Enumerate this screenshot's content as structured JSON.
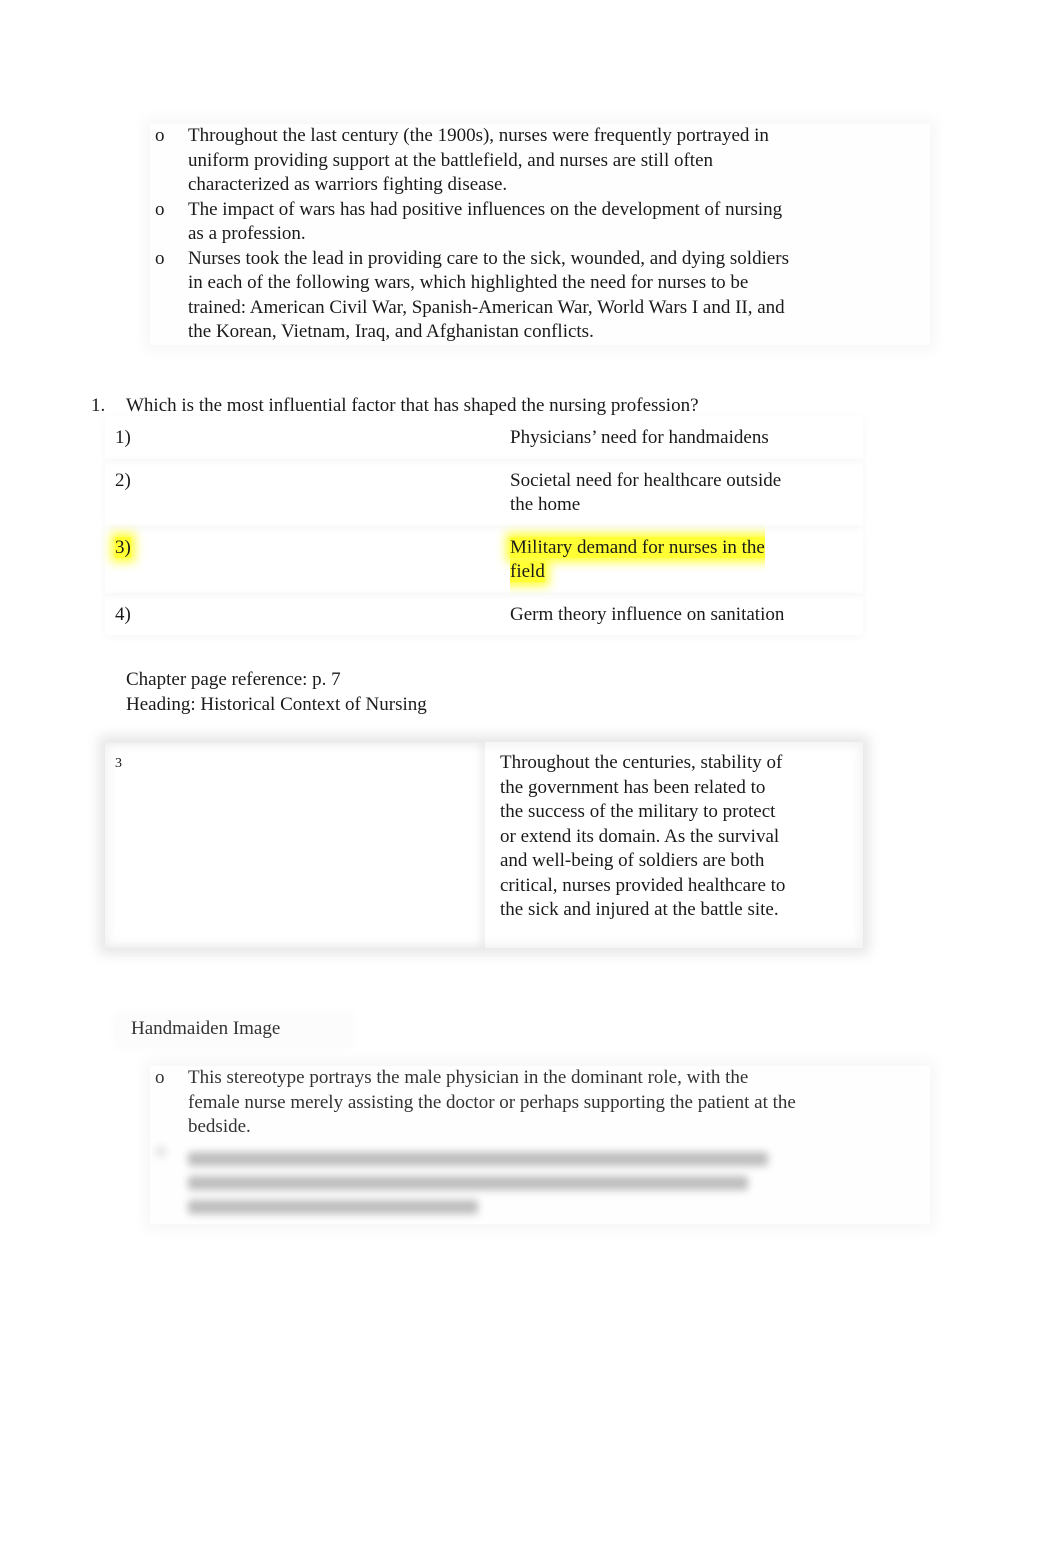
{
  "top_bullets": {
    "marker": "o",
    "items": [
      "Throughout the last century (the 1900s), nurses were frequently portrayed in uniform providing support at the battlefield, and nurses are still often characterized as warriors fighting disease.",
      "The impact of wars has had positive influences on the development of nursing as a profession.",
      "Nurses took the lead in providing care to the sick, wounded, and dying soldiers in each of the following wars, which highlighted the need for nurses to be trained: American Civil War, Spanish-American War, World Wars I and II, and the Korean, Vietnam, Iraq, and Afghanistan conflicts."
    ]
  },
  "question": {
    "number": "1.",
    "text": "Which is the most influential factor that has shaped the nursing profession?",
    "options": [
      {
        "label": "1)",
        "text": "Physicians’ need for handmaidens",
        "highlighted": false
      },
      {
        "label": "2)",
        "text": "Societal need for healthcare outside the home",
        "highlighted": false
      },
      {
        "label": "3)",
        "text": "Military demand for nurses in the field",
        "highlighted": true
      },
      {
        "label": "4)",
        "text": "Germ theory influence on sanitation",
        "highlighted": false
      }
    ],
    "highlight_color": "#ffff33",
    "chapter_reference": "Chapter page reference: p. 7",
    "heading": "Heading: Historical Context of Nursing",
    "answer": "3",
    "rationale": "Throughout the centuries, stability of the government has been related to the success of the military to protect or extend its domain. As the survival and well-being of soldiers are both critical, nurses provided healthcare to the sick and injured at the battle site."
  },
  "section": {
    "title": "Handmaiden Image",
    "bullets": [
      "This stereotype portrays the male physician in the dominant role, with the female nurse merely assisting the doctor or perhaps supporting the patient at the bedside."
    ]
  }
}
